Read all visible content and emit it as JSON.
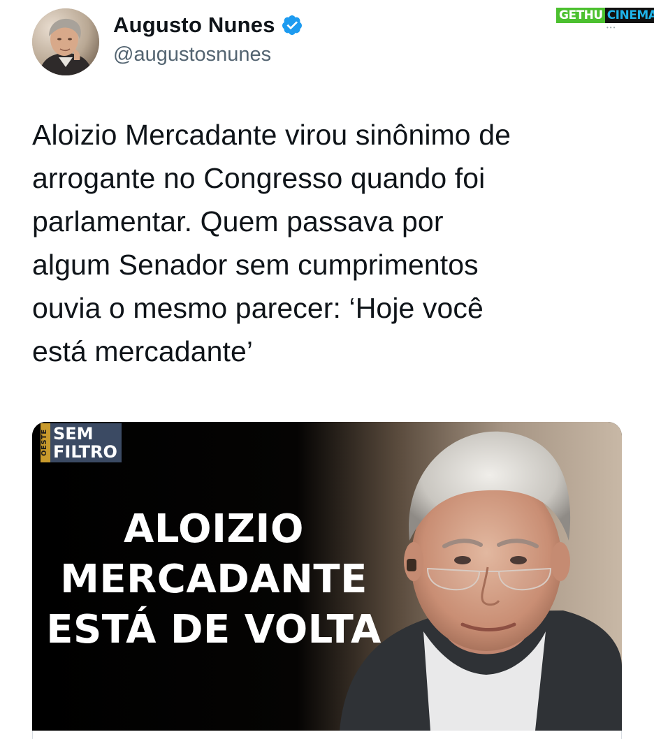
{
  "watermark": {
    "part1": "GETHU",
    "part2": "CINEMA",
    "dots": "•••"
  },
  "author": {
    "display_name": "Augusto Nunes",
    "handle": "@augustosnunes",
    "verified": true
  },
  "tweet": {
    "text": "Aloizio Mercadante virou sinônimo de\narrogante no Congresso quando foi\nparlamentar. Quem passava por\nalgum Senador sem cumprimentos\nouvia o mesmo parecer: ‘Hoje você\nestá mercadante’"
  },
  "media": {
    "badge_brand": "OESTE",
    "badge_line1": "SEM",
    "badge_line2": "FILTRO",
    "headline_lines": [
      "ALOIZIO",
      "MERCADANTE",
      "ESTÁ DE VOLTA"
    ]
  },
  "colors": {
    "verified_badge": "#1d9bf0",
    "handle": "#536471",
    "text": "#0f1419",
    "badge_bg": "#3b4a63",
    "badge_brand": "#c89a2c"
  }
}
